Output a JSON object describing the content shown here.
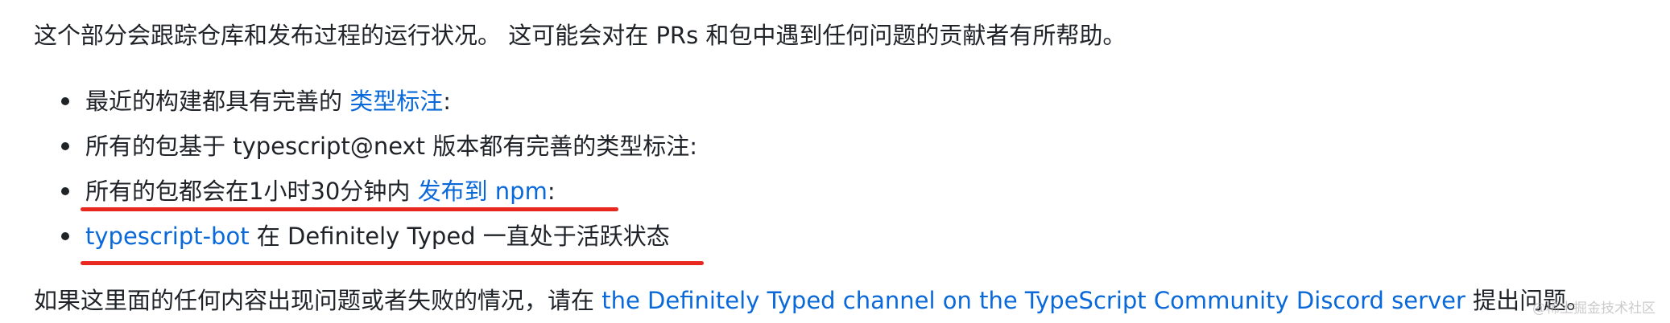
{
  "intro": "这个部分会跟踪仓库和发布过程的运行状况。 这可能会对在 PRs 和包中遇到任何问题的贡献者有所帮助。",
  "bullets": [
    {
      "before": "最近的构建都具有完善的 ",
      "link": "类型标注",
      "after": ":"
    },
    {
      "before": "所有的包基于 typescript@next 版本都有完善的类型标注:",
      "link": "",
      "after": ""
    },
    {
      "before": "所有的包都会在1小时30分钟内 ",
      "link": "发布到 npm",
      "after": ":"
    },
    {
      "before": "",
      "link": "typescript-bot",
      "after": " 在 Definitely Typed 一直处于活跃状态"
    }
  ],
  "outro": {
    "before": "如果这里面的任何内容出现问题或者失败的情况，请在 ",
    "link": "the Definitely Typed channel on the TypeScript Community Discord server",
    "after": " 提出问题。"
  },
  "watermark": "@稀土掘金技术社区",
  "colors": {
    "text": "#1f2328",
    "link": "#0969da",
    "annotation": "#e8271f"
  }
}
